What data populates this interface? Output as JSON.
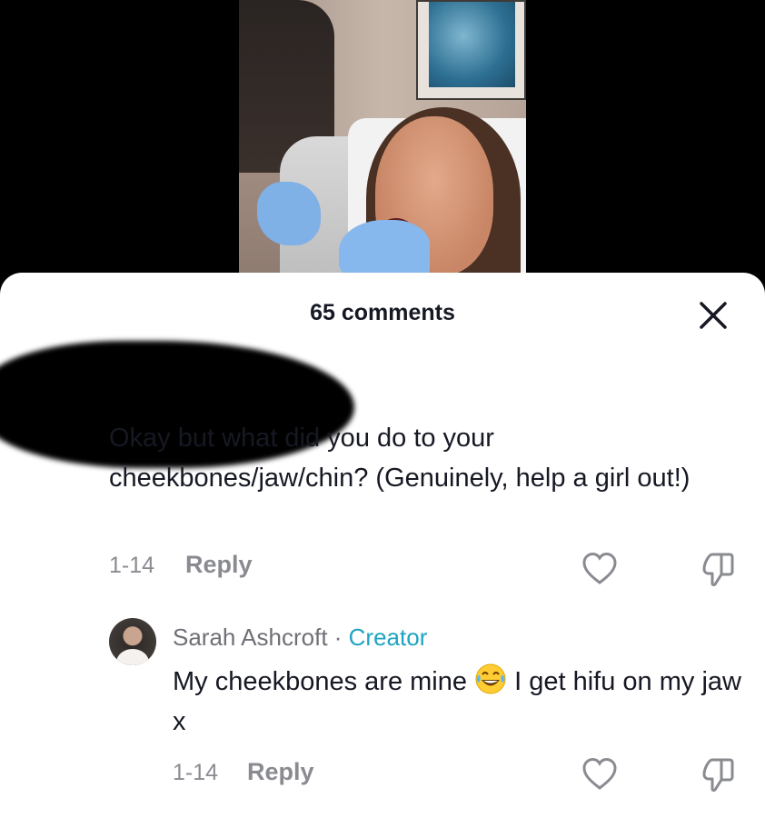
{
  "sheet": {
    "title": "65 comments"
  },
  "comments": [
    {
      "author": "",
      "text": "Okay but what did you do to your cheekbones/jaw/chin? (Genuinely, help a girl out!)",
      "date": "1-14",
      "reply_label": "Reply"
    }
  ],
  "replies": [
    {
      "author": "Sarah Ashcroft",
      "separator": " · ",
      "badge": "Creator",
      "text_before_emoji": "My cheekbones are mine ",
      "text_after_emoji": " I get hifu on my jaw x",
      "emoji": "tears-of-joy-emoji",
      "date": "1-14",
      "reply_label": "Reply"
    }
  ],
  "colors": {
    "creator_badge": "#1fa4c0",
    "meta_text": "#8a8b91",
    "body_text": "#161823"
  }
}
